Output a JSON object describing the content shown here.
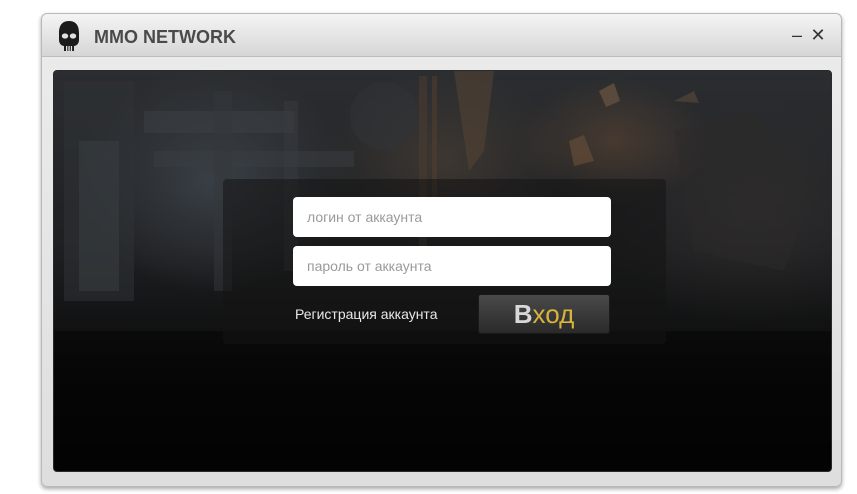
{
  "window": {
    "title": "MMO NETWORK",
    "minimize_label": "–",
    "close_label": "✕"
  },
  "icons": {
    "logo": "skull-mask-icon"
  },
  "login": {
    "login_placeholder": "логин от аккаунта",
    "password_placeholder": "пароль от аккаунта",
    "register_label": "Регистрация аккаунта",
    "button_first": "В",
    "button_rest": "ход"
  },
  "colors": {
    "title_text": "#4a4a4a",
    "button_accent": "#d8b43a"
  }
}
